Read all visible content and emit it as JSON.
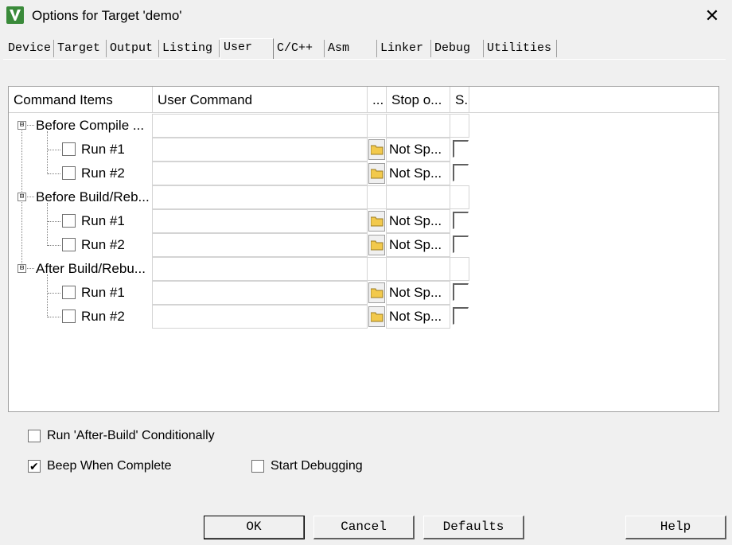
{
  "window": {
    "title": "Options for Target 'demo'",
    "close_glyph": "✕"
  },
  "tabs": [
    {
      "label": "Device"
    },
    {
      "label": "Target"
    },
    {
      "label": "Output"
    },
    {
      "label": "Listing"
    },
    {
      "label": "User"
    },
    {
      "label": "C/C++"
    },
    {
      "label": "Asm"
    },
    {
      "label": "Linker"
    },
    {
      "label": "Debug"
    },
    {
      "label": "Utilities"
    }
  ],
  "active_tab": "User",
  "grid": {
    "headers": [
      "Command Items",
      "User Command",
      "...",
      "Stop o...",
      "S."
    ],
    "groups": [
      {
        "label": "Before Compile ...",
        "expander": "⊟",
        "items": [
          {
            "label": "Run #1",
            "command": "",
            "stop": "Not Sp...",
            "checked": false
          },
          {
            "label": "Run #2",
            "command": "",
            "stop": "Not Sp...",
            "checked": false
          }
        ]
      },
      {
        "label": "Before Build/Reb...",
        "expander": "⊟",
        "items": [
          {
            "label": "Run #1",
            "command": "",
            "stop": "Not Sp...",
            "checked": false
          },
          {
            "label": "Run #2",
            "command": "",
            "stop": "Not Sp...",
            "checked": false
          }
        ]
      },
      {
        "label": "After Build/Rebu...",
        "expander": "⊟",
        "items": [
          {
            "label": "Run #1",
            "command": "",
            "stop": "Not Sp...",
            "checked": false
          },
          {
            "label": "Run #2",
            "command": "",
            "stop": "Not Sp...",
            "checked": false
          }
        ]
      }
    ]
  },
  "options": {
    "run_after_build": {
      "label": "Run 'After-Build' Conditionally",
      "checked": false
    },
    "beep": {
      "label": "Beep When Complete",
      "checked": true
    },
    "start_debugging": {
      "label": "Start Debugging",
      "checked": false
    }
  },
  "buttons": {
    "ok": "OK",
    "cancel": "Cancel",
    "defaults": "Defaults",
    "help": "Help"
  },
  "colors": {
    "dialog_bg": "#f0f0f0",
    "grid_bg": "#ffffff",
    "icon_green": "#3a8a3a",
    "folder_yellow": "#f2c94c"
  }
}
